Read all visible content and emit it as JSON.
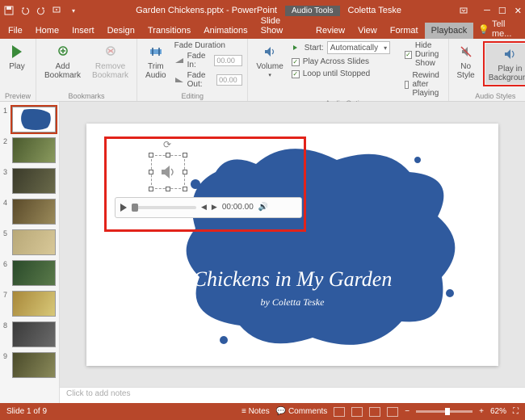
{
  "titlebar": {
    "document_title": "Garden Chickens.pptx - PowerPoint",
    "context_tool": "Audio Tools",
    "user_name": "Coletta Teske"
  },
  "tabs": {
    "file": "File",
    "home": "Home",
    "insert": "Insert",
    "design": "Design",
    "transitions": "Transitions",
    "animations": "Animations",
    "slideshow": "Slide Show",
    "review": "Review",
    "view": "View",
    "format": "Format",
    "playback": "Playback",
    "tellme": "Tell me..."
  },
  "ribbon": {
    "preview": {
      "play": "Play",
      "group": "Preview"
    },
    "bookmarks": {
      "add": "Add\nBookmark",
      "remove": "Remove\nBookmark",
      "group": "Bookmarks"
    },
    "editing": {
      "trim": "Trim\nAudio",
      "fade_label": "Fade Duration",
      "fade_in": "Fade In:",
      "fade_out": "Fade Out:",
      "fade_in_val": "00.00",
      "fade_out_val": "00.00",
      "group": "Editing"
    },
    "audio_options": {
      "volume": "Volume",
      "start_label": "Start:",
      "start_value": "Automatically",
      "play_across": "Play Across Slides",
      "loop": "Loop until Stopped",
      "hide": "Hide During Show",
      "rewind": "Rewind after Playing",
      "group": "Audio Options"
    },
    "audio_styles": {
      "no_style": "No\nStyle",
      "play_bg": "Play in\nBackground",
      "group": "Audio Styles"
    }
  },
  "slide": {
    "title": "Chickens in My Garden",
    "subtitle": "by Coletta Teske",
    "audio_time": "00:00.00"
  },
  "thumbs": [
    "1",
    "2",
    "3",
    "4",
    "5",
    "6",
    "7",
    "8",
    "9"
  ],
  "notes_placeholder": "Click to add notes",
  "status": {
    "slide_indicator": "Slide 1 of 9",
    "notes": "Notes",
    "comments": "Comments",
    "zoom": "62%"
  }
}
